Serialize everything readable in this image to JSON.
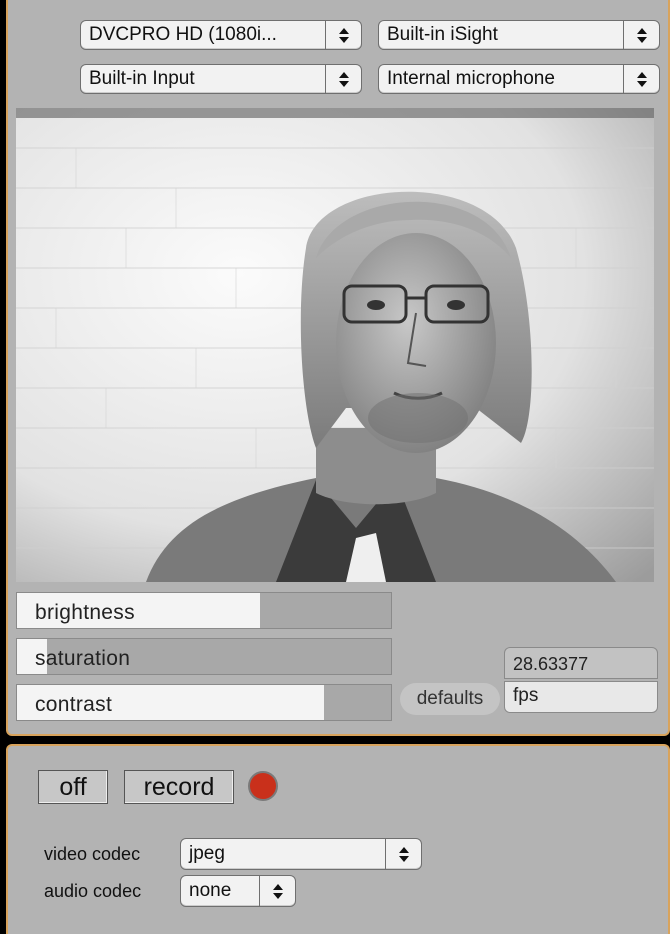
{
  "capture": {
    "video_format": "DVCPRO HD (1080i...",
    "video_device": "Built-in iSight",
    "audio_input": "Built-in Input",
    "audio_device": "Internal microphone"
  },
  "adjustments": {
    "brightness": {
      "label": "brightness",
      "value": 0.65
    },
    "saturation": {
      "label": "saturation",
      "value": 0.08
    },
    "contrast": {
      "label": "contrast",
      "value": 0.82
    }
  },
  "defaults_label": "defaults",
  "fps": {
    "value": "28.63377",
    "label": "fps"
  },
  "controls": {
    "off_label": "off",
    "record_label": "record"
  },
  "codecs": {
    "video_label": "video codec",
    "video_value": "jpeg",
    "audio_label": "audio codec",
    "audio_value": "none"
  },
  "colors": {
    "panel_border": "#d8a35c",
    "record_indicator": "#c9301b"
  }
}
